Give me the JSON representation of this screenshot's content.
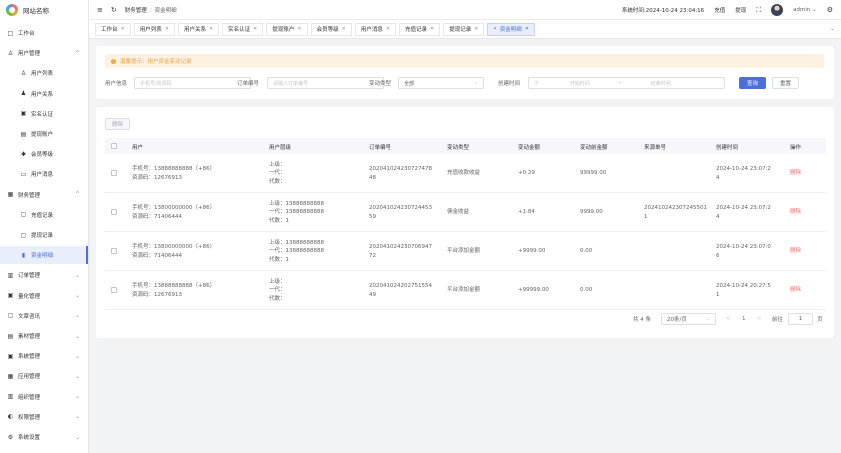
{
  "site": {
    "name": "网站名称"
  },
  "sidebar": {
    "items": [
      {
        "label": "工作台",
        "icon": "monitor-icon",
        "glyph": "□",
        "arrow": ""
      },
      {
        "label": "用户管理",
        "icon": "user-icon",
        "glyph": "♙",
        "arrow": "^"
      },
      {
        "label": "用户列表",
        "icon": "user-icon",
        "glyph": "♙",
        "arrow": ""
      },
      {
        "label": "用户关系",
        "icon": "users-icon",
        "glyph": "♟",
        "arrow": ""
      },
      {
        "label": "实名认证",
        "icon": "idcard-icon",
        "glyph": "▣",
        "arrow": ""
      },
      {
        "label": "提现账户",
        "icon": "wallet-icon",
        "glyph": "▤",
        "arrow": ""
      },
      {
        "label": "会员等级",
        "icon": "level-icon",
        "glyph": "✱",
        "arrow": ""
      },
      {
        "label": "用户消息",
        "icon": "message-icon",
        "glyph": "▭",
        "arrow": ""
      },
      {
        "label": "财务管理",
        "icon": "finance-icon",
        "glyph": "▦",
        "arrow": "^"
      },
      {
        "label": "充值记录",
        "icon": "recharge-icon",
        "glyph": "▢",
        "arrow": ""
      },
      {
        "label": "提现记录",
        "icon": "withdraw-icon",
        "glyph": "▢",
        "arrow": ""
      },
      {
        "label": "资金明细",
        "icon": "chart-icon",
        "glyph": "▮",
        "arrow": ""
      },
      {
        "label": "订单管理",
        "icon": "order-icon",
        "glyph": "▥",
        "arrow": "⌄"
      },
      {
        "label": "量化管理",
        "icon": "quant-icon",
        "glyph": "▣",
        "arrow": "⌄"
      },
      {
        "label": "文章咨讯",
        "icon": "article-icon",
        "glyph": "▢",
        "arrow": "⌄"
      },
      {
        "label": "素材管理",
        "icon": "material-icon",
        "glyph": "▤",
        "arrow": "⌄"
      },
      {
        "label": "系统管理",
        "icon": "system-icon",
        "glyph": "▣",
        "arrow": "⌄"
      },
      {
        "label": "应用管理",
        "icon": "app-icon",
        "glyph": "▦",
        "arrow": "⌄"
      },
      {
        "label": "组织管理",
        "icon": "org-icon",
        "glyph": "▥",
        "arrow": "⌄"
      },
      {
        "label": "权限管理",
        "icon": "lock-icon",
        "glyph": "◐",
        "arrow": "⌄"
      },
      {
        "label": "系统设置",
        "icon": "gear-icon",
        "glyph": "⚙",
        "arrow": "⌄"
      }
    ]
  },
  "header": {
    "crumb1": "财务管理",
    "crumb_sep": "/",
    "crumb2": "资金明细",
    "time_label": "系统时间:",
    "time": "2024-10-24 23:04:16",
    "recharge": "充值",
    "withdraw": "提现",
    "user": "admin"
  },
  "tabs": [
    {
      "label": "工作台"
    },
    {
      "label": "用户列表"
    },
    {
      "label": "用户关系"
    },
    {
      "label": "实名认证"
    },
    {
      "label": "提现账户"
    },
    {
      "label": "会员等级"
    },
    {
      "label": "用户消息"
    },
    {
      "label": "充值记录"
    },
    {
      "label": "提现记录"
    },
    {
      "label": "资金明细"
    }
  ],
  "alert": {
    "text": "温馨提示：用户资金变动记录"
  },
  "filters": {
    "user_label": "用户信息",
    "user_ph": "手机号/资源码",
    "order_label": "订单编号",
    "order_ph": "请输入订单编号",
    "type_label": "变动类型",
    "type_value": "全部",
    "time_label": "创建时间",
    "start_ph": "开始时间",
    "to": "-",
    "end_ph": "结束时间",
    "search": "查询",
    "reset": "重置"
  },
  "table": {
    "delete": "删除",
    "headers": [
      "用户",
      "用户层级",
      "订单编号",
      "变动类型",
      "变动金额",
      "变动前金额",
      "来源单号",
      "创建时间",
      "操作"
    ],
    "rows": [
      {
        "user1": "手机号：13888888888（+86）",
        "user2": "资源码：12676913",
        "lvl1": "上级：",
        "lvl2": "一代：",
        "lvl3": "代数：",
        "order1": "202041024230727478",
        "order2": "48",
        "type": "充值收款收益",
        "amount": "+0.29",
        "before": "99999.00",
        "src1": "",
        "src2": "",
        "t1": "2024-10-24 23:07:2",
        "t2": "4",
        "op": "删除"
      },
      {
        "user1": "手机号：13800000000（+86）",
        "user2": "资源码：71406444",
        "lvl1": "上级：13888888888",
        "lvl2": "一代：13888888888",
        "lvl3": "代数：1",
        "order1": "202041024230724453",
        "order2": "59",
        "type": "佣金收益",
        "amount": "+1.84",
        "before": "9999.00",
        "src1": "202410242307245501",
        "src2": "1",
        "t1": "2024-10-24 23:07:2",
        "t2": "4",
        "op": "删除"
      },
      {
        "user1": "手机号：13800000000（+86）",
        "user2": "资源码：71406444",
        "lvl1": "上级：13888888888",
        "lvl2": "一代：13888888888",
        "lvl3": "代数：1",
        "order1": "202041024230706947",
        "order2": "72",
        "type": "平台添加金额",
        "amount": "+9999.00",
        "before": "0.00",
        "src1": "",
        "src2": "",
        "t1": "2024-10-24 23:07:0",
        "t2": "6",
        "op": "删除"
      },
      {
        "user1": "手机号：13888888888（+86）",
        "user2": "资源码：12676913",
        "lvl1": "上级：",
        "lvl2": "一代：",
        "lvl3": "代数：",
        "order1": "202041024202751554",
        "order2": "49",
        "type": "平台添加金额",
        "amount": "+99999.00",
        "before": "0.00",
        "src1": "",
        "src2": "",
        "t1": "2024-10-24 20:27:5",
        "t2": "1",
        "op": "删除"
      }
    ]
  },
  "pagination": {
    "total": "共 4 条",
    "size": "20条/页",
    "page": "1",
    "goto": "前往",
    "goto_val": "1",
    "page_unit": "页",
    "prev": "<",
    "next": ">"
  }
}
